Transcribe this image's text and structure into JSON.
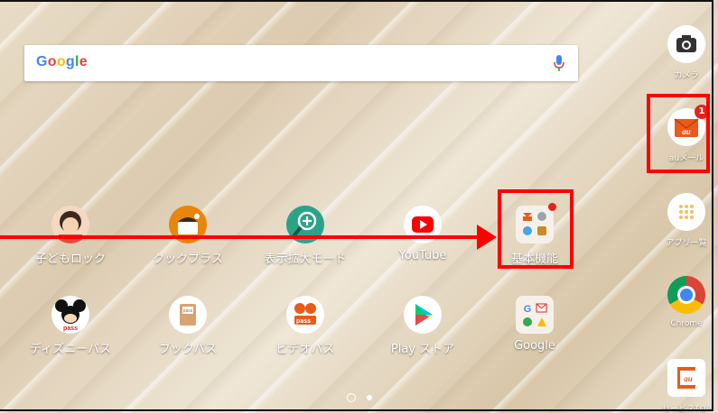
{
  "search": {
    "logo": "Google"
  },
  "apps_row1": [
    {
      "label": "子どもロック",
      "icon": "child-lock-icon"
    },
    {
      "label": "クックプラス",
      "icon": "cook-plus-icon"
    },
    {
      "label": "表示拡大モード",
      "icon": "magnify-mode-icon"
    },
    {
      "label": "YouTube",
      "icon": "youtube-icon"
    },
    {
      "label": "基本機能",
      "icon": "basic-functions-folder-icon"
    }
  ],
  "apps_row2": [
    {
      "label": "ディズニーパス",
      "icon": "disney-pass-icon"
    },
    {
      "label": "ブックパス",
      "icon": "book-pass-icon"
    },
    {
      "label": "ビデオパス",
      "icon": "video-pass-icon",
      "text": "pass"
    },
    {
      "label": "Play ストア",
      "icon": "play-store-icon"
    },
    {
      "label": "Google",
      "icon": "google-folder-icon"
    }
  ],
  "dock": [
    {
      "label": "カメラ",
      "icon": "camera-icon"
    },
    {
      "label": "auメール",
      "icon": "au-mail-icon",
      "badge": "1"
    },
    {
      "label": "アプリ一覧",
      "icon": "app-drawer-icon"
    },
    {
      "label": "Chrome",
      "icon": "chrome-icon"
    },
    {
      "label": "サービスTOP",
      "icon": "service-top-icon"
    }
  ],
  "icon_text": {
    "au": "au",
    "pass": "pass"
  },
  "colors": {
    "highlight": "#ff0000",
    "badge": "#e5231b"
  }
}
